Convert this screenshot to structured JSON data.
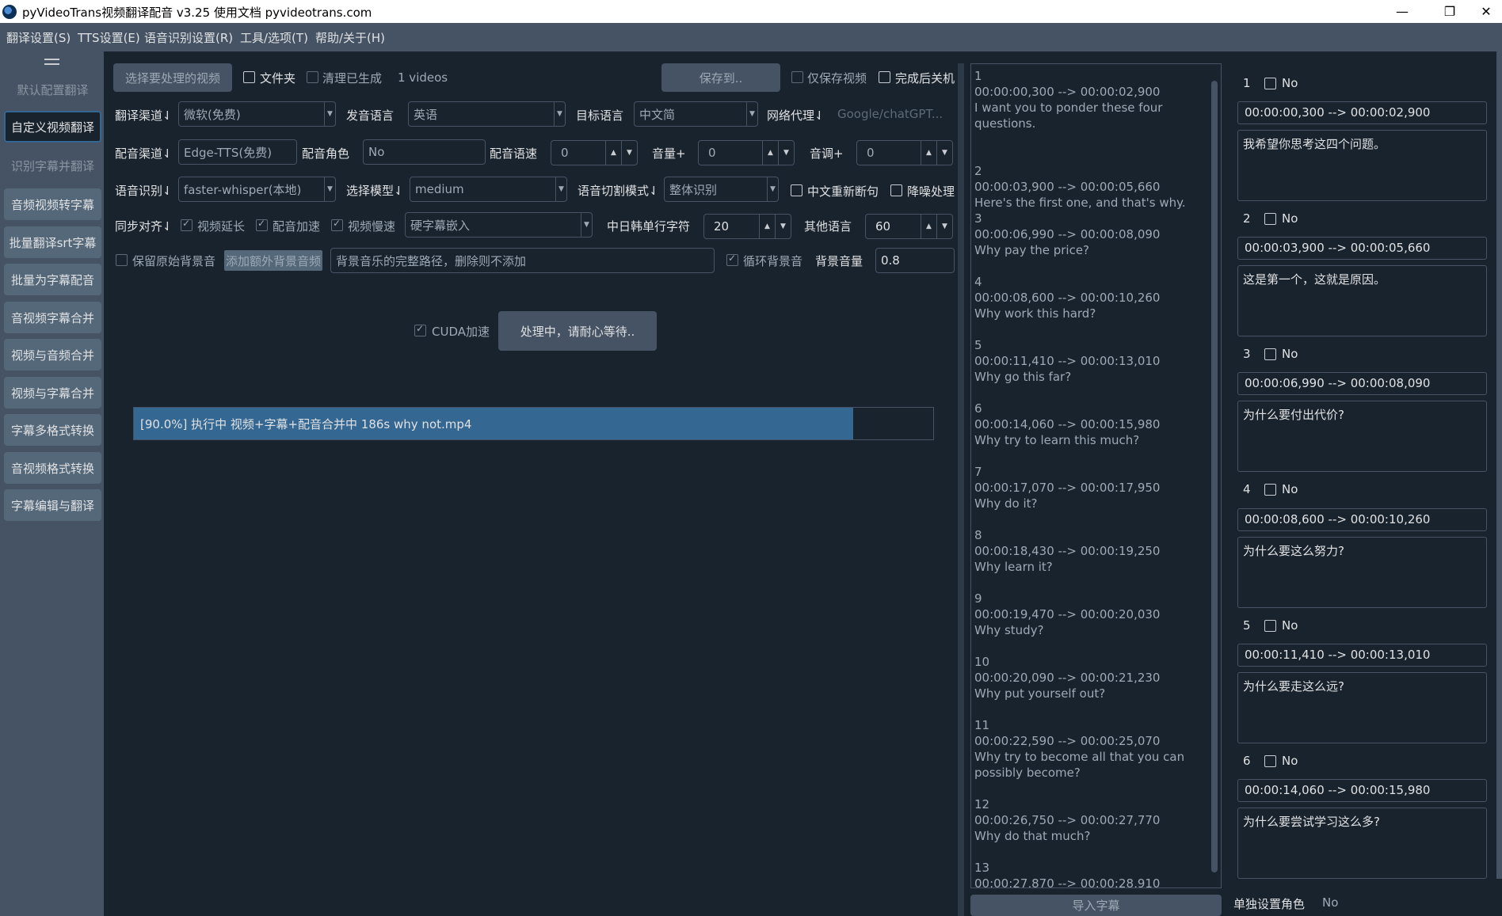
{
  "window": {
    "title": "pyVideoTrans视频翻译配音 v3.25  使用文档  pyvideotrans.com",
    "minimize": "—",
    "maximize": "❐",
    "close": "✕"
  },
  "menubar": [
    "翻译设置(S)",
    "TTS设置(E)",
    "语音识别设置(R)",
    "工具/选项(T)",
    "帮助/关于(H)"
  ],
  "sidebar": {
    "items": [
      {
        "label": "默认配置翻译",
        "state": "dim"
      },
      {
        "label": "自定义视频翻译",
        "state": "active"
      },
      {
        "label": "识别字幕并翻译",
        "state": "dim"
      },
      {
        "label": "音频视频转字幕",
        "state": "raised"
      },
      {
        "label": "批量翻译srt字幕",
        "state": "raised"
      },
      {
        "label": "批量为字幕配音",
        "state": "raised"
      },
      {
        "label": "音视频字幕合并",
        "state": "raised"
      },
      {
        "label": "视频与音频合并",
        "state": "raised"
      },
      {
        "label": "视频与字幕合并",
        "state": "raised"
      },
      {
        "label": "字幕多格式转换",
        "state": "raised"
      },
      {
        "label": "音视频格式转换",
        "state": "raised"
      },
      {
        "label": "字幕编辑与翻译",
        "state": "raised"
      }
    ]
  },
  "main": {
    "select_video": "选择要处理的视频",
    "folder": "文件夹",
    "clear_generated": "清理已生成",
    "video_count": "1 videos",
    "save_to": "保存到..",
    "only_save_video": "仅保存视频",
    "shutdown_after": "完成后关机",
    "translate_channel_label": "翻译渠道⇃",
    "translate_channel": "微软(免费)",
    "source_lang_label": "发音语言",
    "source_lang": "英语",
    "target_lang_label": "目标语言",
    "target_lang": "中文简",
    "proxy_label": "网络代理⇃",
    "proxy_placeholder": "Google/chatGPT...",
    "dub_channel_label": "配音渠道⇃",
    "dub_channel": "Edge-TTS(免费)",
    "dub_role_label": "配音角色",
    "dub_role": "No",
    "dub_speed_label": "配音语速",
    "dub_speed": "0",
    "volume_label": "音量+",
    "volume": "0",
    "pitch_label": "音调+",
    "pitch": "0",
    "asr_label": "语音识别⇃",
    "asr": "faster-whisper(本地)",
    "model_label": "选择模型⇃",
    "model": "medium",
    "split_mode_label": "语音切割模式⇃",
    "split_mode": "整体识别",
    "zh_resplit": "中文重新断句",
    "denoise": "降噪处理",
    "sync_label": "同步对齐⇃",
    "video_extend": "视频延长",
    "dub_speedup": "配音加速",
    "video_slow": "视频慢速",
    "subtitle_mode": "硬字幕嵌入",
    "cjk_chars_label": "中日韩单行字符",
    "cjk_chars": "20",
    "other_lang_label": "其他语言",
    "other_lang": "60",
    "keep_bgm": "保留原始背景音",
    "add_bgm": "添加额外背景音频",
    "bgm_path_placeholder": "背景音乐的完整路径，删除则不添加",
    "loop_bgm": "循环背景音",
    "bgm_volume_label": "背景音量",
    "bgm_volume": "0.8",
    "cuda": "CUDA加速",
    "start_button": "处理中，请耐心等待..",
    "progress": {
      "percent": 0.9,
      "text": "[90.0%]  执行中 视频+字幕+配音合并中 186s   why not.mp4"
    }
  },
  "srt_list": [
    {
      "index": "1",
      "time": "00:00:00,300 --> 00:00:02,900",
      "text": "I want you to ponder these four questions."
    },
    {
      "index": "2",
      "time": "00:00:03,900 --> 00:00:05,660",
      "text": "Here's the first one, and that's why."
    },
    {
      "index": "3",
      "time": "00:00:06,990 --> 00:00:08,090",
      "text": "Why pay the price?"
    },
    {
      "index": "4",
      "time": "00:00:08,600 --> 00:00:10,260",
      "text": "Why work this hard?"
    },
    {
      "index": "5",
      "time": "00:00:11,410 --> 00:00:13,010",
      "text": "Why go this far?"
    },
    {
      "index": "6",
      "time": "00:00:14,060 --> 00:00:15,980",
      "text": "Why try to learn this much?"
    },
    {
      "index": "7",
      "time": "00:00:17,070 --> 00:00:17,950",
      "text": "Why do it?"
    },
    {
      "index": "8",
      "time": "00:00:18,430 --> 00:00:19,250",
      "text": "Why learn it?"
    },
    {
      "index": "9",
      "time": "00:00:19,470 --> 00:00:20,030",
      "text": "Why study?"
    },
    {
      "index": "10",
      "time": "00:00:20,090 --> 00:00:21,230",
      "text": "Why put yourself out?"
    },
    {
      "index": "11",
      "time": "00:00:22,590 --> 00:00:25,070",
      "text": "Why try to become all that you can possibly become?"
    },
    {
      "index": "12",
      "time": "00:00:26,750 --> 00:00:27,770",
      "text": "Why do that much?"
    },
    {
      "index": "13",
      "time": "00:00:27,870 --> 00:00:28,910",
      "text": ""
    }
  ],
  "import_subtitles": "导入字幕",
  "editor": {
    "items": [
      {
        "index": "1",
        "role": "No",
        "time": "00:00:00,300 --> 00:00:02,900",
        "text": "我希望你思考这四个问题。"
      },
      {
        "index": "2",
        "role": "No",
        "time": "00:00:03,900 --> 00:00:05,660",
        "text": "这是第一个，这就是原因。"
      },
      {
        "index": "3",
        "role": "No",
        "time": "00:00:06,990 --> 00:00:08,090",
        "text": "为什么要付出代价?"
      },
      {
        "index": "4",
        "role": "No",
        "time": "00:00:08,600 --> 00:00:10,260",
        "text": "为什么要这么努力?"
      },
      {
        "index": "5",
        "role": "No",
        "time": "00:00:11,410 --> 00:00:13,010",
        "text": "为什么要走这么远?"
      },
      {
        "index": "6",
        "role": "No",
        "time": "00:00:14,060 --> 00:00:15,980",
        "text": "为什么要尝试学习这么多?"
      }
    ],
    "single_role_label": "单独设置角色",
    "single_role_value": "No"
  }
}
